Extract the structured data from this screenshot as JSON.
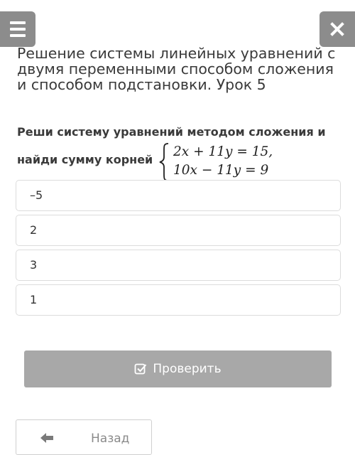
{
  "header": {
    "menu_icon": "hamburger-menu-icon",
    "close_icon": "close-icon",
    "title": "Решение системы линейных уравнений с двумя переменными способом сложения и способом подстановки. Урок 5"
  },
  "question": {
    "line1": "Реши систему уравнений методом сложения и",
    "line2": "найди сумму корней",
    "equation1": "2x + 11y = 15,",
    "equation2": "10x − 11y = 9"
  },
  "options": [
    "–5",
    "2",
    "3",
    "1"
  ],
  "check_button": {
    "label": "Проверить",
    "icon": "checkbox-check-icon"
  },
  "back_button": {
    "label": "Назад",
    "icon": "arrow-left-icon"
  },
  "colors": {
    "header_button_bg": "#8c8c8c",
    "check_button_bg": "#a8a8a8",
    "option_border": "#dcdcdc"
  }
}
